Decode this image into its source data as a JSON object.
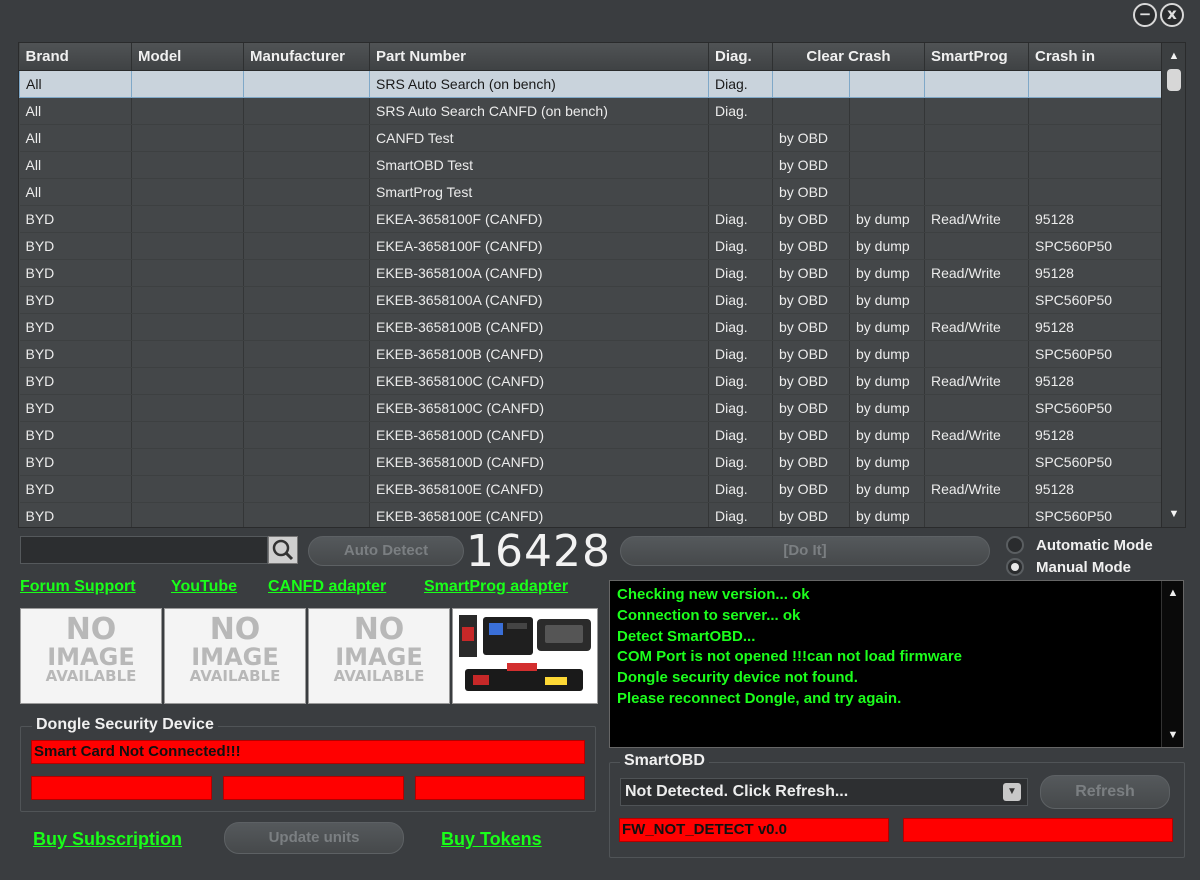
{
  "window": {
    "minimize_glyph": "−",
    "close_glyph": "x"
  },
  "table": {
    "columns": [
      {
        "label": "Brand"
      },
      {
        "label": "Model"
      },
      {
        "label": "Manufacturer"
      },
      {
        "label": "Part Number"
      },
      {
        "label": "Diag."
      },
      {
        "label": "Clear Crash"
      },
      {
        "label": "SmartProg"
      },
      {
        "label": "Crash in"
      }
    ],
    "rows": [
      [
        "All",
        "",
        "",
        "SRS Auto Search (on bench)",
        "Diag.",
        "",
        "",
        "",
        ""
      ],
      [
        "All",
        "",
        "",
        "SRS Auto Search CANFD (on bench)",
        "Diag.",
        "",
        "",
        "",
        ""
      ],
      [
        "All",
        "",
        "",
        "CANFD Test",
        "",
        "by OBD",
        "",
        "",
        ""
      ],
      [
        "All",
        "",
        "",
        "SmartOBD Test",
        "",
        "by OBD",
        "",
        "",
        ""
      ],
      [
        "All",
        "",
        "",
        "SmartProg Test",
        "",
        "by OBD",
        "",
        "",
        ""
      ],
      [
        "BYD",
        "",
        "",
        "EKEA-3658100F (CANFD)",
        "Diag.",
        "by OBD",
        "by dump",
        "Read/Write",
        "95128"
      ],
      [
        "BYD",
        "",
        "",
        "EKEA-3658100F (CANFD)",
        "Diag.",
        "by OBD",
        "by dump",
        "",
        "SPC560P50"
      ],
      [
        "BYD",
        "",
        "",
        "EKEB-3658100A (CANFD)",
        "Diag.",
        "by OBD",
        "by dump",
        "Read/Write",
        "95128"
      ],
      [
        "BYD",
        "",
        "",
        "EKEB-3658100A (CANFD)",
        "Diag.",
        "by OBD",
        "by dump",
        "",
        "SPC560P50"
      ],
      [
        "BYD",
        "",
        "",
        "EKEB-3658100B (CANFD)",
        "Diag.",
        "by OBD",
        "by dump",
        "Read/Write",
        "95128"
      ],
      [
        "BYD",
        "",
        "",
        "EKEB-3658100B (CANFD)",
        "Diag.",
        "by OBD",
        "by dump",
        "",
        "SPC560P50"
      ],
      [
        "BYD",
        "",
        "",
        "EKEB-3658100C (CANFD)",
        "Diag.",
        "by OBD",
        "by dump",
        "Read/Write",
        "95128"
      ],
      [
        "BYD",
        "",
        "",
        "EKEB-3658100C (CANFD)",
        "Diag.",
        "by OBD",
        "by dump",
        "",
        "SPC560P50"
      ],
      [
        "BYD",
        "",
        "",
        "EKEB-3658100D (CANFD)",
        "Diag.",
        "by OBD",
        "by dump",
        "Read/Write",
        "95128"
      ],
      [
        "BYD",
        "",
        "",
        "EKEB-3658100D (CANFD)",
        "Diag.",
        "by OBD",
        "by dump",
        "",
        "SPC560P50"
      ],
      [
        "BYD",
        "",
        "",
        "EKEB-3658100E (CANFD)",
        "Diag.",
        "by OBD",
        "by dump",
        "Read/Write",
        "95128"
      ],
      [
        "BYD",
        "",
        "",
        "EKEB-3658100E (CANFD)",
        "Diag.",
        "by OBD",
        "by dump",
        "",
        "SPC560P50"
      ]
    ],
    "selected_row": 0
  },
  "controls": {
    "search_value": "",
    "auto_detect_label": "Auto Detect",
    "counter": "16428",
    "do_it_label": "[Do It]",
    "mode_automatic": "Automatic Mode",
    "mode_manual": "Manual Mode",
    "selected_mode": "manual"
  },
  "links": {
    "forum": "Forum Support",
    "youtube": "YouTube",
    "canfd": "CANFD adapter",
    "smartprog": "SmartProg adapter",
    "buy_subscription": "Buy Subscription",
    "buy_tokens": "Buy Tokens"
  },
  "images": {
    "no_image_l1": "NO",
    "no_image_l2": "IMAGE",
    "no_image_l3": "AVAILABLE"
  },
  "dongle": {
    "title": "Dongle Security Device",
    "status": "Smart Card Not Connected!!!",
    "field1": "",
    "field2": "",
    "field3": "",
    "update_units_label": "Update units"
  },
  "log": {
    "lines": [
      "Checking new version... ok",
      "Connection to server... ok",
      "Detect SmartOBD...",
      "COM Port is not opened !!!can not load firmware",
      "Dongle security device not found.",
      "Please reconnect Dongle, and try again."
    ]
  },
  "smartobd": {
    "title": "SmartOBD",
    "combo_value": "Not Detected. Click Refresh...",
    "refresh_label": "Refresh",
    "fw_status": "FW_NOT_DETECT v0.0",
    "fw_extra": ""
  },
  "colors": {
    "accent_green": "#19ff19",
    "error_red": "#ff0000",
    "background": "#3a3d40"
  }
}
